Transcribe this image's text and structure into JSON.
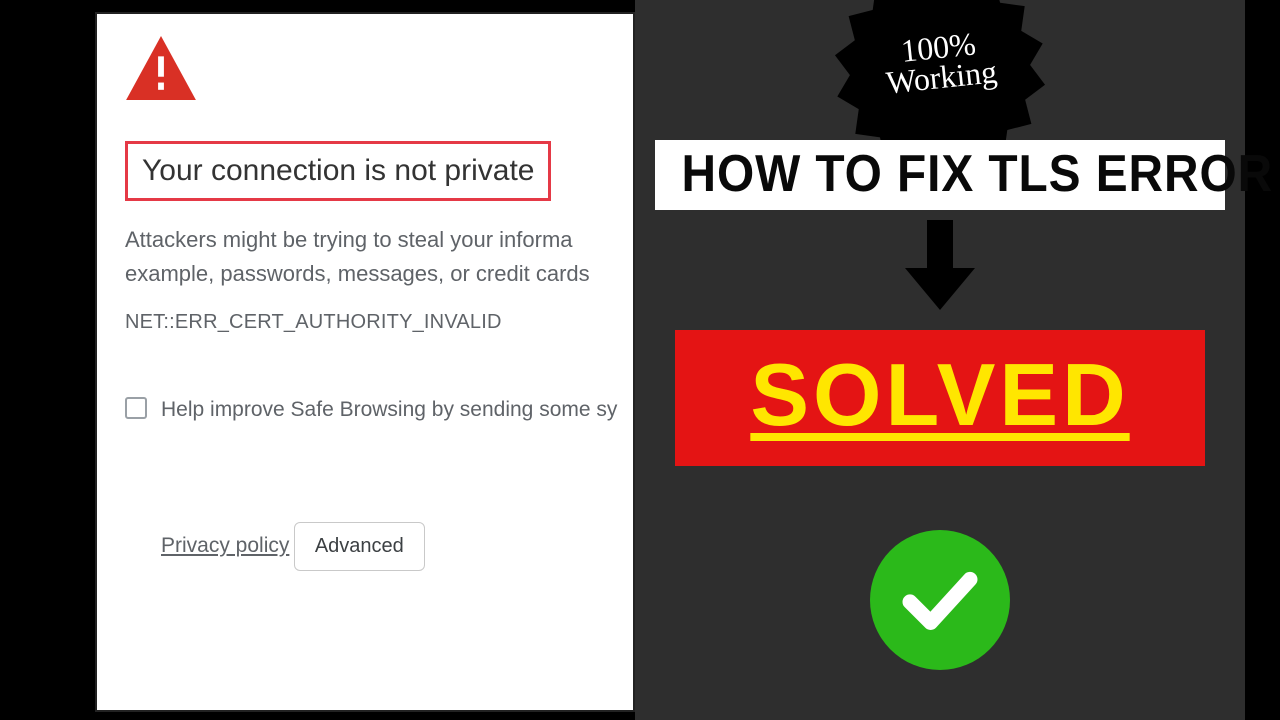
{
  "chrome_error": {
    "headline": "Your connection is not private",
    "body_line1": "Attackers might be trying to steal your informa",
    "body_line2": "example, passwords, messages, or credit cards",
    "error_code": "NET::ERR_CERT_AUTHORITY_INVALID",
    "checkbox_label": "Help improve Safe Browsing by sending some sy",
    "privacy_link": "Privacy policy",
    "advanced_button": "Advanced"
  },
  "overlay": {
    "badge_line1": "100%",
    "badge_line2": "Working",
    "title": "HOW TO FIX TLS ERROR",
    "solved": "SOLVED"
  },
  "colors": {
    "warn_red": "#d93025",
    "highlight_border": "#e53946",
    "solved_bg": "#e41414",
    "solved_text": "#ffe600",
    "check_green": "#2bb91a"
  }
}
